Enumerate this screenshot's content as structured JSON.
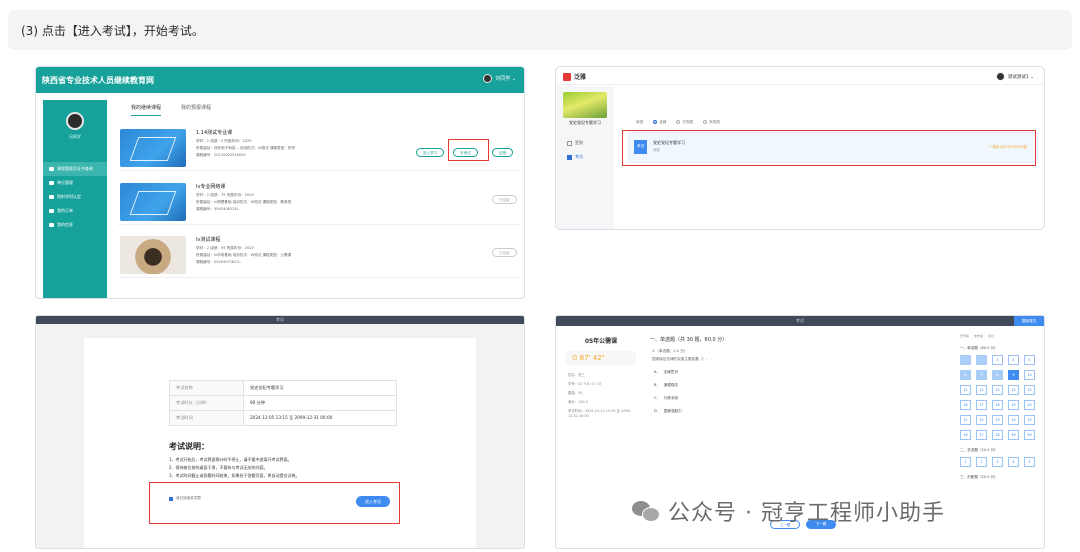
{
  "note": "(3) 点击【进入考试】，开始考试。",
  "s1": {
    "site_title": "陕西省专业技术人员继续教育网",
    "user": "刘同学 ⌄",
    "side_name": "吕同学",
    "side_items": [
      "课程管理及证书查询",
      "单位管理",
      "照射学时认定",
      "我的订单",
      "我的信息"
    ],
    "tabs": [
      "我的继续课程",
      "我的预报课程"
    ],
    "courses": [
      {
        "title": "1.14测试专业课",
        "meta1": "学时：2            成绩：0            所属年份：2025",
        "meta2": "所属届站：西安电子科技...     培训形式：W测试     课程类型：药学",
        "meta3": "课程编号：20110022510001",
        "buttons": [
          "进入学习",
          "去考试",
          "证明"
        ]
      },
      {
        "title": "lv专业网络课",
        "meta1": "学时：2            成绩：75           所属年份：2025",
        "meta2": "所属届站：lv物理基础         培训形式：W测试     课程类型：教育类",
        "meta3": "课程编号：3942406125l...",
        "buttons": [
          "已结束"
        ]
      },
      {
        "title": "lv测试课程",
        "meta1": "学时：2            成绩：95           所属年份：2025",
        "meta2": "所属届站：lv市场基础         培训形式：W测试     课程类型：公需课",
        "meta3": "课程编号：0520497l3l23...",
        "buttons": [
          "已结束"
        ]
      }
    ]
  },
  "s2": {
    "logo": "泛雅",
    "user": "测试测试1 ⌄",
    "course_name": "党史党纪专题学习",
    "side_items": [
      "签到",
      "考试"
    ],
    "filter_label": "状态",
    "filters": [
      "全部",
      "已完成",
      "未完成"
    ],
    "exam_tag": "考试",
    "exam_title": "党史党纪专题学习",
    "exam_sub": "待做",
    "exam_time": "⏱ 剩余1天23小时59分钟"
  },
  "s3": {
    "bar_title": "考试",
    "rows": [
      {
        "k": "考试名称",
        "v": "党史党纪专题学习"
      },
      {
        "k": "考试时长（分钟）",
        "v": "90 分钟"
      },
      {
        "k": "考试时间",
        "v": "2024-12-05 13:15 至 2099-12-31 00:00"
      }
    ],
    "heading": "考试说明：",
    "rules": [
      "1、考试开始后，考试界面倒计时不停止，请不要中途离开考试界面。",
      "2、保持座位前的桌面干净，不要有与考试无关的内容。",
      "3、考试时间截止或答题时间结束，如果处于答题页面，将自动提交试卷。"
    ],
    "agree": "我已阅读并同意",
    "enter_button": "进入考试"
  },
  "s4": {
    "bar_title": "考试",
    "submit": "整卷提交",
    "exam_name": "05年公需课",
    "timer": "⏱ 87' 42\"",
    "info": [
      "姓名：张三",
      "学号：02 9 8 l 0 l 37",
      "题量：50",
      "满分：100.0",
      "考试时间：2025-01-12 15:30 至 2099-12-31 00:00"
    ],
    "section_title": "一、单选题（共 30 题，60.0 分）",
    "question": "3.（单选题，2.0 分）",
    "question_text": "国家保证法律的实施主要依靠（）。",
    "options": [
      {
        "k": "A.",
        "t": "法律意识"
      },
      {
        "k": "B.",
        "t": "道德观念"
      },
      {
        "k": "C.",
        "t": "行政手段"
      },
      {
        "k": "D.",
        "t": "国家强制力"
      }
    ],
    "prev": "上一题",
    "next": "下一题",
    "legend": [
      "已作答",
      "未作答",
      "标记"
    ],
    "grid_sections": [
      "一、单选题（60.0 分）",
      "二、多选题（20.0 分）",
      "三、判断题（20.0 分）"
    ],
    "grid1": [
      "1",
      "2",
      "3",
      "4",
      "5",
      "6",
      "7",
      "8",
      "9",
      "10",
      "11",
      "12",
      "13",
      "14",
      "15",
      "16",
      "17",
      "18",
      "19",
      "20",
      "21",
      "22",
      "23",
      "24",
      "25",
      "26",
      "27",
      "28",
      "29",
      "30"
    ],
    "grid2": [
      "1",
      "2",
      "3",
      "4",
      "5"
    ],
    "watermark": "公众号 · 冠亨工程师小助手"
  }
}
